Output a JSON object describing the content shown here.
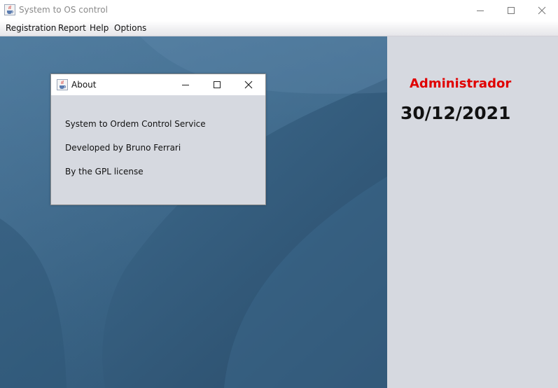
{
  "window": {
    "title": "System to OS control",
    "icon": "java-cup-icon"
  },
  "menu": {
    "items": [
      {
        "label": "Registration"
      },
      {
        "label": "Report"
      },
      {
        "label": "Help"
      },
      {
        "label": "Options"
      }
    ]
  },
  "side_panel": {
    "user": "Administrador",
    "date": "30/12/2021",
    "user_color": "#e00000"
  },
  "about_dialog": {
    "title": "About",
    "lines": [
      "System to Ordem Control Service",
      "Developed by Bruno Ferrari",
      "By the GPL license"
    ]
  },
  "colors": {
    "desktop_bg": "#35607f",
    "panel_bg": "#d6d9e0"
  }
}
